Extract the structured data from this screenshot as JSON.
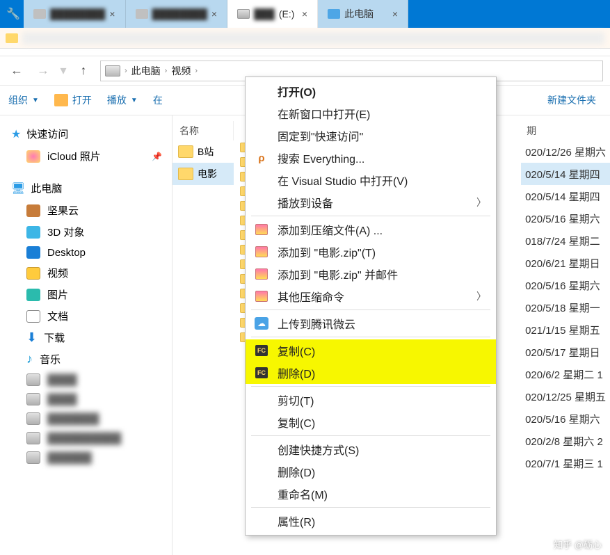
{
  "tabs": {
    "drive": "(E:)",
    "pc": "此电脑"
  },
  "breadcrumb": {
    "a": "此电脑",
    "b": "视频"
  },
  "cmdbar": {
    "organize": "组织",
    "open": "打开",
    "play": "播放",
    "in": "在",
    "newfolder": "新建文件夹"
  },
  "sidebar": {
    "quick": "快速访问",
    "icloud": "iCloud 照片",
    "thispc": "此电脑",
    "jianguo": "坚果云",
    "obj3d": "3D 对象",
    "desktop": "Desktop",
    "video": "视频",
    "pic": "图片",
    "docs": "文档",
    "download": "下载",
    "music": "音乐"
  },
  "columns": {
    "name": "名称",
    "date": "期"
  },
  "files": {
    "row0": "B站",
    "row1": "电影"
  },
  "dates": [
    "020/12/26 星期六",
    "020/5/14 星期四",
    "020/5/14 星期四",
    "020/5/16 星期六",
    "018/7/24 星期二",
    "020/6/21 星期日",
    "020/5/16 星期六",
    "020/5/18 星期一",
    "021/1/15 星期五",
    "020/5/17 星期日",
    "020/6/2 星期二 1",
    "020/12/25 星期五",
    "020/5/16 星期六",
    "020/2/8 星期六 2",
    "020/7/1 星期三 1"
  ],
  "menu": {
    "open": "打开(O)",
    "newwin": "在新窗口中打开(E)",
    "pin": "固定到\"快速访问\"",
    "search": "搜索 Everything...",
    "vs": "在 Visual Studio 中打开(V)",
    "playto": "播放到设备",
    "addzip": "添加到压缩文件(A) ...",
    "addmovie": "添加到 \"电影.zip\"(T)",
    "addmail": "添加到 \"电影.zip\" 并邮件",
    "othercomp": "其他压缩命令",
    "upload": "上传到腾讯微云",
    "fccopy": "复制(C)",
    "fcdelete": "删除(D)",
    "cut": "剪切(T)",
    "copy": "复制(C)",
    "shortcut": "创建快捷方式(S)",
    "delete": "删除(D)",
    "rename": "重命名(M)",
    "props": "属性(R)"
  },
  "watermark": "知乎 @砺心"
}
